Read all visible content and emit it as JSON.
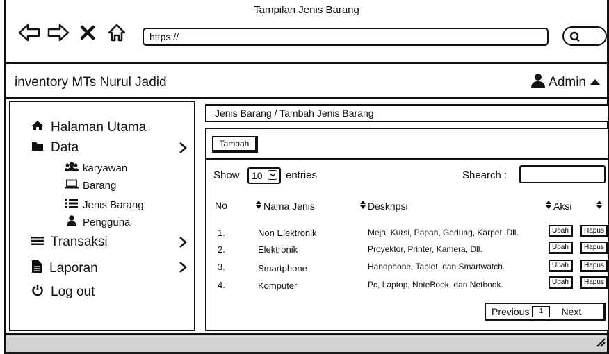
{
  "window": {
    "title": "Tampilan Jenis Barang",
    "url": "https://"
  },
  "header": {
    "app_title": "inventory MTs Nurul Jadid",
    "user_label": "Admin"
  },
  "sidebar": {
    "items": [
      {
        "label": "Halaman Utama",
        "icon": "home-icon"
      },
      {
        "label": "Data",
        "icon": "folder-icon"
      },
      {
        "label": "Transaksi",
        "icon": "menu-icon"
      },
      {
        "label": "Laporan",
        "icon": "document-icon"
      },
      {
        "label": "Log out",
        "icon": "power-icon"
      }
    ],
    "sub_items": [
      {
        "label": "karyawan",
        "icon": "users-icon"
      },
      {
        "label": "Barang",
        "icon": "laptop-icon"
      },
      {
        "label": "Jenis Barang",
        "icon": "list-icon"
      },
      {
        "label": "Pengguna",
        "icon": "user-icon"
      }
    ]
  },
  "main": {
    "breadcrumb": "Jenis Barang / Tambah Jenis Barang",
    "add_button": "Tambah",
    "show_label": "Show",
    "entries_value": "10",
    "entries_label": "entries",
    "search_label": "Shearch :",
    "columns": [
      "No",
      "Nama Jenis",
      "Deskripsi",
      "Aksi"
    ],
    "rows": [
      {
        "no": "1.",
        "nama": "Non Elektronik",
        "deskripsi": "Meja, Kursi, Papan, Gedung, Karpet, Dll."
      },
      {
        "no": "2.",
        "nama": "Elektronik",
        "deskripsi": "Proyektor, Printer, Kamera, Dll."
      },
      {
        "no": "3.",
        "nama": "Smartphone",
        "deskripsi": "Handphone, Tablet, dan Smartwatch."
      },
      {
        "no": "4.",
        "nama": "Komputer",
        "deskripsi": "Pc, Laptop, NoteBook, dan Netbook."
      }
    ],
    "edit_label": "Ubah",
    "delete_label": "Hapus",
    "pagination": {
      "previous": "Previous",
      "page": "1",
      "next": "Next"
    }
  }
}
